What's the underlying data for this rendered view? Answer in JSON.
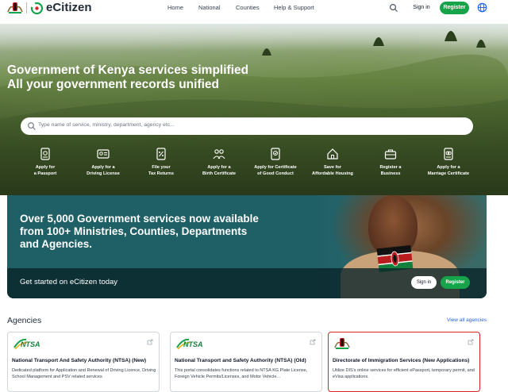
{
  "header": {
    "brand": "eCitizen",
    "nav": [
      "Home",
      "National",
      "Counties",
      "Help & Support"
    ],
    "sign_in": "Sign in",
    "register": "Register"
  },
  "hero": {
    "title_line1_plain": "Government of Kenya services ",
    "title_line1_em": "simplified",
    "title_line2_plain": "All your government records ",
    "title_line2_em": "unified",
    "search_placeholder": "Type name of service, ministry, department, agency etc...",
    "quick_links": [
      {
        "label": "Apply for\na Passport",
        "icon": "passport-icon"
      },
      {
        "label": "Apply for a\nDriving License",
        "icon": "driving-license-icon"
      },
      {
        "label": "File your\nTax Returns",
        "icon": "tax-returns-icon"
      },
      {
        "label": "Apply for a\nBirth Certificate",
        "icon": "birth-certificate-icon"
      },
      {
        "label": "Apply for Certificate\nof Good Conduct",
        "icon": "good-conduct-icon"
      },
      {
        "label": "Save for\nAffordable Housing",
        "icon": "housing-icon"
      },
      {
        "label": "Register a\nBusiness",
        "icon": "business-icon"
      },
      {
        "label": "Apply for a\nMarriage Certificate",
        "icon": "marriage-certificate-icon"
      }
    ]
  },
  "promo": {
    "line1": "Over 5,000 Government services now available",
    "line2": "from 100+ Ministries, Counties, Departments",
    "line3": "and Agencies.",
    "cta": "Get started on eCitizen today",
    "sign_in": "Sign in",
    "register": "Register"
  },
  "agencies": {
    "heading": "Agencies",
    "view_all": "View all agencies",
    "cards": [
      {
        "logo": "NTSA",
        "title": "National Transport And Safety Authority (NTSA) (New)",
        "description": "Dedicated platform for Application and Renewal of Driving Licence, Driving School Management and PSV related services"
      },
      {
        "logo": "NTSA",
        "title": "National Transport and Safety Authority (NTSA) (Old)",
        "description": "This portal consolidates functions related to NTSA KG Plate License, Foreign Vehicle Permits/Licenses, and Motor Vehicle..."
      },
      {
        "logo": "coat-of-arms",
        "title": "Directorate of Immigration Services (New Applications)",
        "description": "Utilize DIS's online services for efficient ePassport, temporary permit, and eVisa applications."
      }
    ]
  },
  "colors": {
    "accent_green": "#16a34a",
    "promo_teal": "#1f5f66",
    "highlight_red": "#dc2626",
    "link_blue": "#2563eb"
  }
}
